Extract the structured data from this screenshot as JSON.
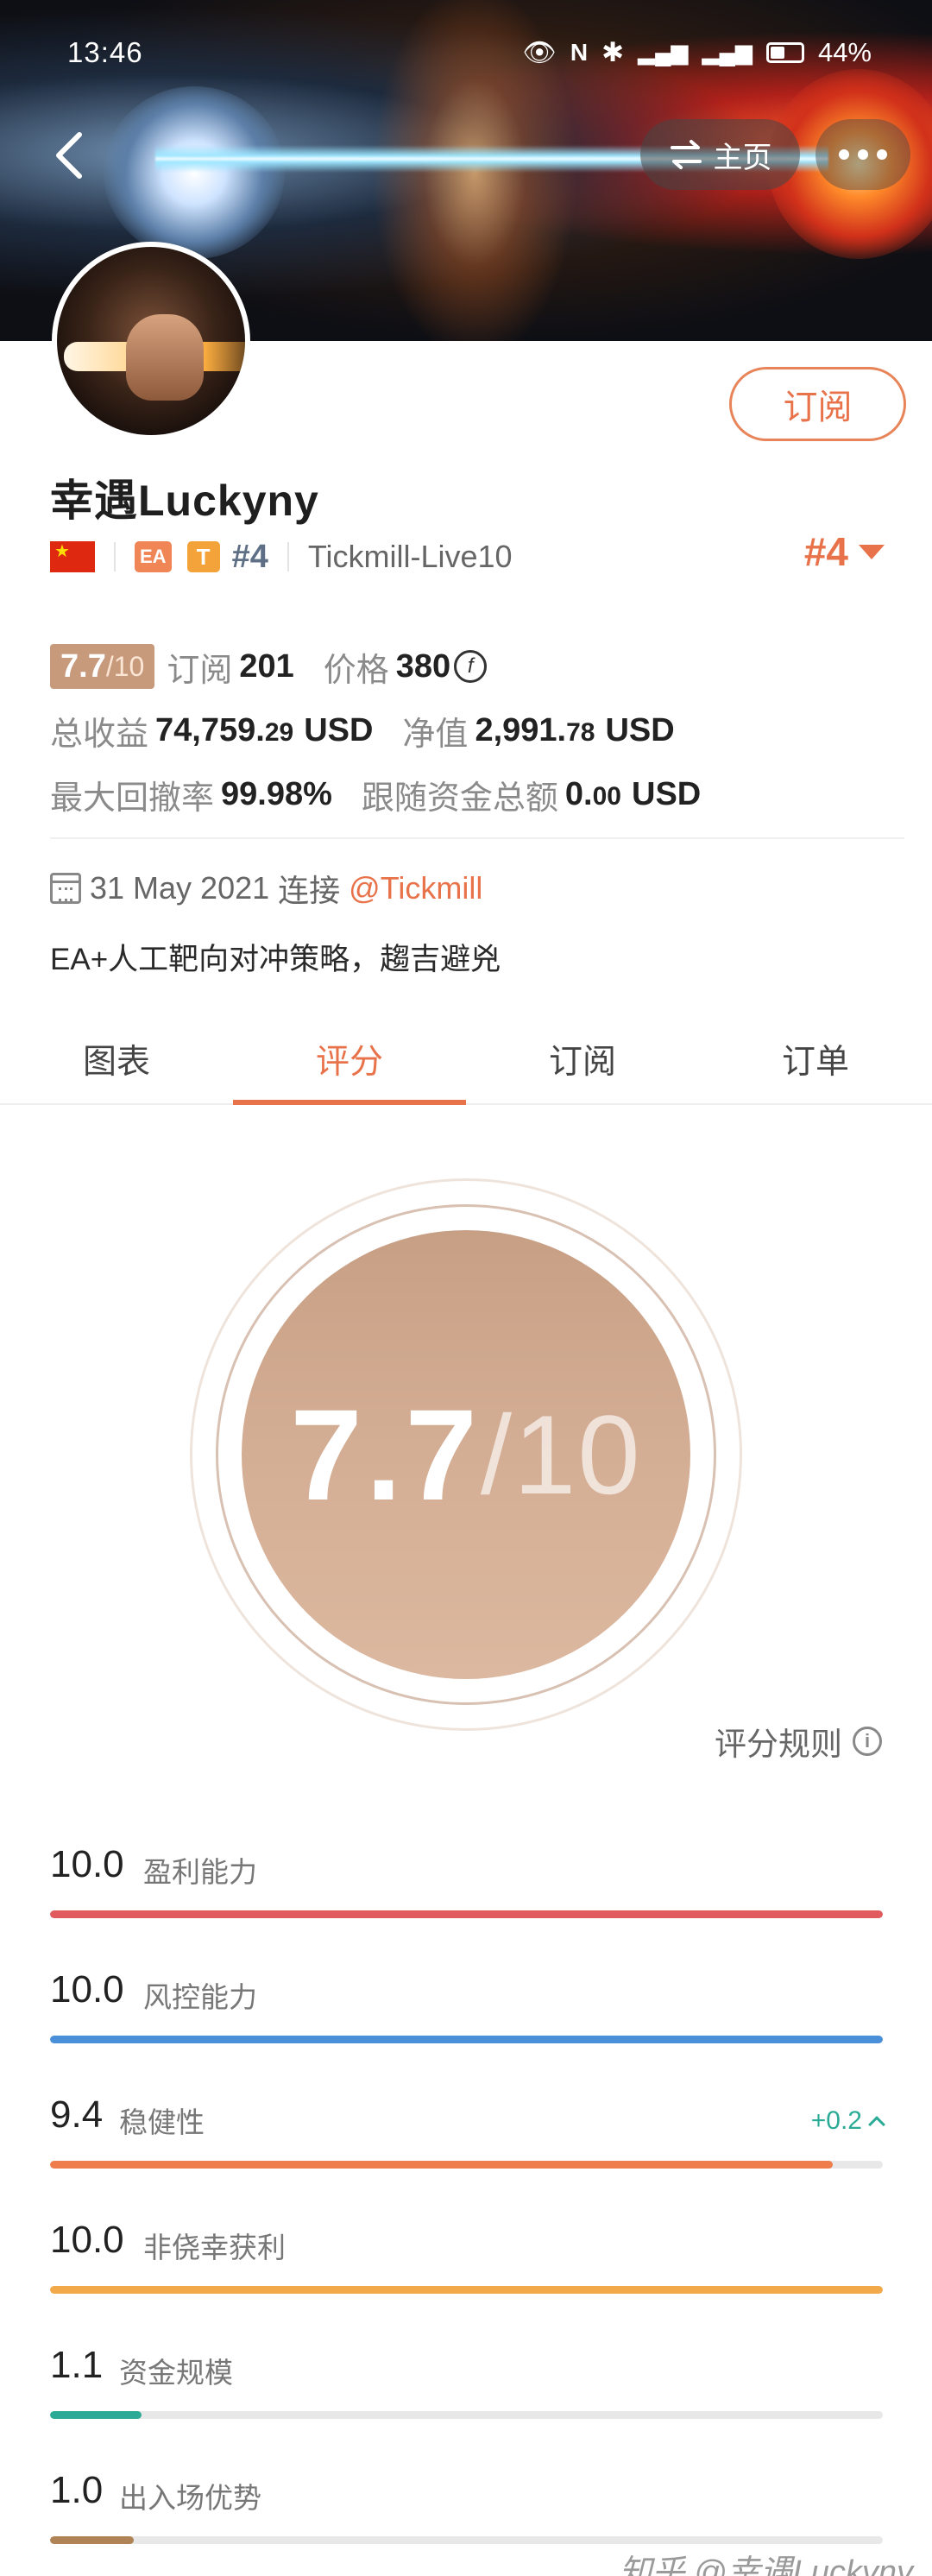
{
  "status": {
    "time": "13:46",
    "battery": "44%"
  },
  "nav": {
    "home_label": "主页"
  },
  "profile": {
    "name": "幸遇Luckyny",
    "tag_ea": "EA",
    "tag_t": "T",
    "rank_small": "#4",
    "server": "Tickmill-Live10",
    "rank_big": "#4",
    "subscribe_label": "订阅"
  },
  "stats": {
    "score": "7.7",
    "score_den": "/10",
    "subscribe_label": "订阅",
    "subscribers": "201",
    "price_label": "价格",
    "price": "380",
    "price_coin": "f",
    "total_profit_label": "总收益",
    "total_profit_int": "74,759.",
    "total_profit_dec": "29",
    "total_profit_unit": "USD",
    "equity_label": "净值",
    "equity_int": "2,991.",
    "equity_dec": "78",
    "equity_unit": "USD",
    "max_drawdown_label": "最大回撤率",
    "max_drawdown": "99.98%",
    "follow_funds_label": "跟随资金总额",
    "follow_funds_int": "0.",
    "follow_funds_dec": "00",
    "follow_funds_unit": "USD"
  },
  "join": {
    "date": "31 May 2021",
    "connect_label": "连接",
    "broker_handle": "@Tickmill"
  },
  "description": "EA+人工靶向对冲策略，趨吉避兇",
  "tabs": [
    {
      "label": "图表"
    },
    {
      "label": "评分"
    },
    {
      "label": "订阅"
    },
    {
      "label": "订单"
    }
  ],
  "rating": {
    "score": "7.7",
    "den": "/10",
    "rules_label": "评分规则"
  },
  "metrics": [
    {
      "value": "10.0",
      "label": "盈利能力",
      "fill": 1.0,
      "color": "#e05a5e"
    },
    {
      "value": "10.0",
      "label": "风控能力",
      "fill": 1.0,
      "color": "#4a90d9"
    },
    {
      "value": "9.4",
      "label": "稳健性",
      "fill": 0.94,
      "color": "#ef7d4b",
      "delta": "+0.2"
    },
    {
      "value": "10.0",
      "label": "非侥幸获利",
      "fill": 1.0,
      "color": "#f2a94a"
    },
    {
      "value": "1.1",
      "label": "资金规模",
      "fill": 0.11,
      "color": "#2bab95"
    },
    {
      "value": "1.0",
      "label": "出入场优势",
      "fill": 0.1,
      "color": "#b08356"
    }
  ],
  "watermark": "知乎 @幸遇Luckyny"
}
